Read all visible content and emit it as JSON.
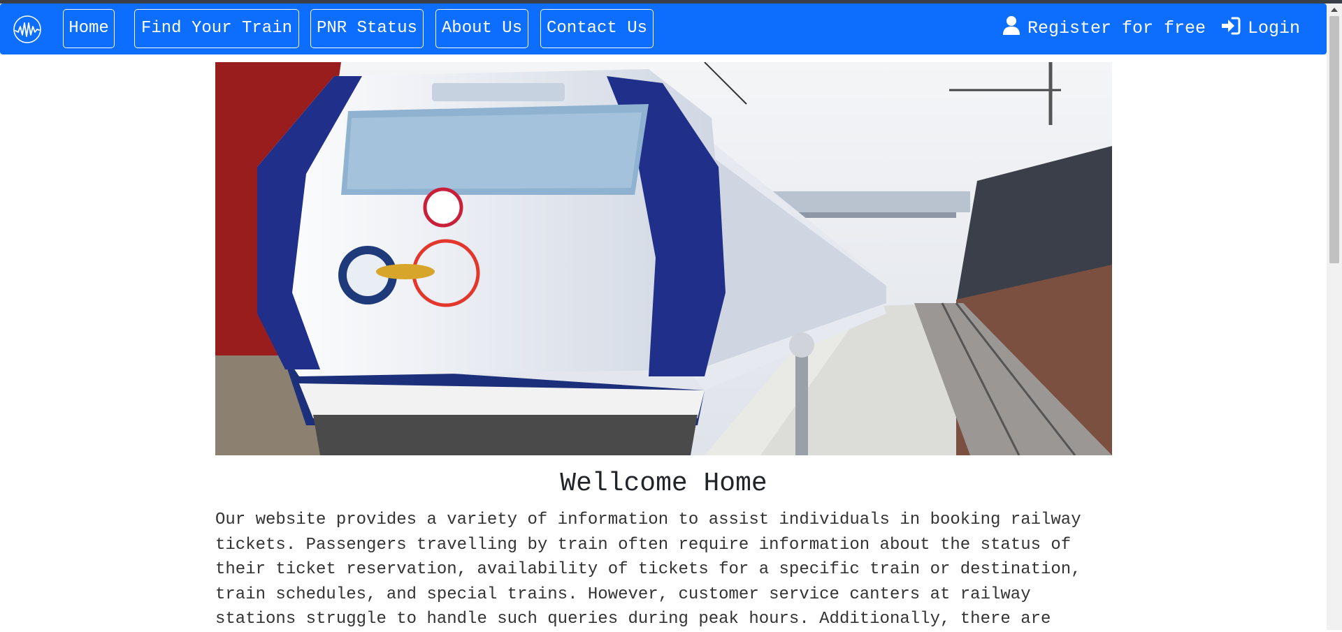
{
  "navbar": {
    "brand_icon": "waveform-logo-icon",
    "links": [
      "Home",
      "Find Your Train",
      "PNR Status",
      "About Us",
      "Contact Us"
    ],
    "register_label": "Register for free",
    "register_icon": "user-icon",
    "login_label": "Login",
    "login_icon": "sign-in-icon",
    "accent_color": "#0d6efd"
  },
  "hero": {
    "image": "vande-bharat-train-photo"
  },
  "main": {
    "title": "Wellcome Home",
    "intro": "Our website provides a variety of information to assist individuals in booking railway tickets. Passengers travelling by train often require information about the status of their ticket reservation, availability of tickets for a specific train or destination, train schedules, and special trains. However, customer service canters at railway stations struggle to handle such queries during peak hours. Additionally, there are"
  }
}
